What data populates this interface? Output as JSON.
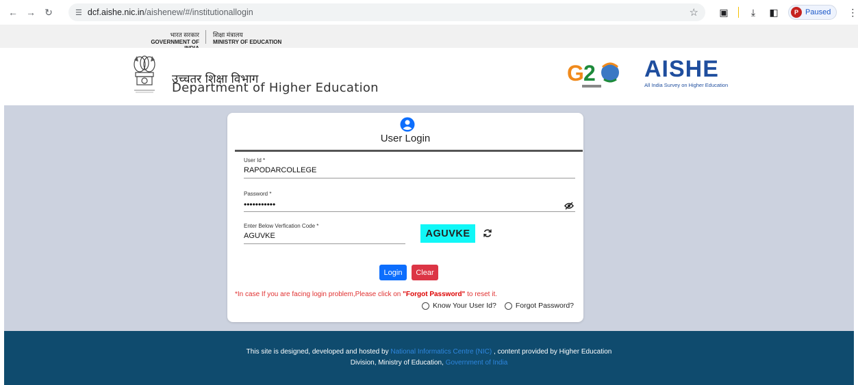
{
  "browser": {
    "url_host": "dcf.aishe.nic.in",
    "url_path": "/aishenew/#/institutionallogin",
    "profile_initial": "P",
    "profile_status": "Paused"
  },
  "gov_bar": {
    "gov_hi": "भारत सरकार",
    "gov_en": "GOVERNMENT OF INDIA",
    "ministry_hi": "शिक्षा मंत्रालय",
    "ministry_en": "MINISTRY OF EDUCATION"
  },
  "header": {
    "dept_hi": "उच्चतर शिक्षा विभाग",
    "dept_en": "Department of Higher Education",
    "aishe_title": "AISHE",
    "aishe_subtitle": "All India Survey on Higher Education"
  },
  "login": {
    "title": "User Login",
    "user_id_label": "User Id *",
    "user_id_value": "RAPODARCOLLEGE",
    "password_label": "Password *",
    "password_value": "•••••••••••",
    "code_label": "Enter Below Verfication Code *",
    "code_value": "AGUVKE",
    "captcha_text": "AGUVKE",
    "login_label": "Login",
    "clear_label": "Clear",
    "note_prefix": "*In case If you are facing login problem,Please click on ",
    "note_bold": "\"Forgot Password\"",
    "note_suffix": " to reset it.",
    "know_user_id_label": "Know Your User Id?",
    "forgot_password_label": "Forgot Password?"
  },
  "footer": {
    "line1_a": "This site is designed, developed and hosted by ",
    "line1_link": "National Informatics Centre (NIC)",
    "line1_b": " , content provided by Higher Education",
    "line2_a": "Division, Ministry of Education, ",
    "line2_link": "Government of India"
  },
  "colors": {
    "footer_bg": "#0f4b6e",
    "main_bg": "#ccd2df",
    "captcha_bg": "#11f7f7",
    "login_btn": "#0d6efd",
    "clear_btn": "#dc3545",
    "aishe_blue": "#1f4e9e"
  }
}
